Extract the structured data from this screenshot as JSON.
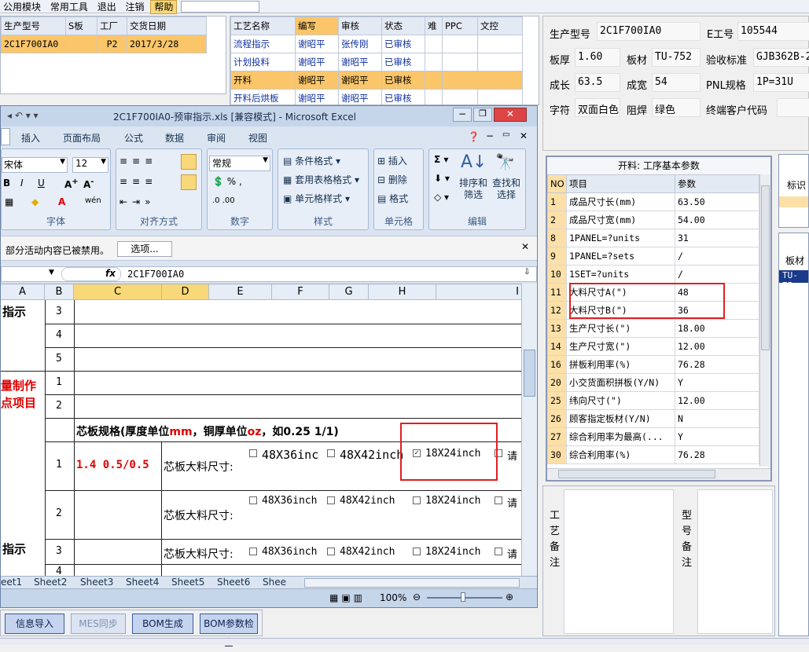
{
  "menubar": {
    "items": [
      "公用模块",
      "常用工具",
      "退出",
      "注销",
      "帮助"
    ],
    "help_arrow": "▾"
  },
  "order_grid": {
    "headers": [
      "生产型号",
      "S板",
      "工厂",
      "交货日期"
    ],
    "rows": [
      [
        "2C1F700IA0",
        "",
        "P2",
        "2017/3/28"
      ]
    ]
  },
  "process_grid": {
    "headers": [
      "工艺名称",
      "编写",
      "审核",
      "状态",
      "难",
      "PPC",
      "文控"
    ],
    "rows": [
      [
        "流程指示",
        "谢昭平",
        "张传刚",
        "已审核",
        "",
        "",
        ""
      ],
      [
        "计划投料",
        "谢昭平",
        "谢昭平",
        "已审核",
        "",
        "",
        ""
      ],
      [
        "开料",
        "谢昭平",
        "谢昭平",
        "已审核",
        "",
        "",
        ""
      ],
      [
        "开料后烘板",
        "谢昭平",
        "谢昭平",
        "已审核",
        "",
        "",
        ""
      ]
    ],
    "selected_row": 2
  },
  "info": {
    "model_label": "生产型号",
    "model_value": "2C1F700IA0",
    "e_label": "E工号",
    "e_value": "105544",
    "thick_label": "板厚",
    "thick_value": "1.60",
    "mat_label": "板材",
    "mat_value": "TU-752",
    "std_label": "验收标准",
    "std_value": "GJB362B-2",
    "len_label": "成长",
    "len_value": "63.5",
    "wid_label": "成宽",
    "wid_value": "54",
    "pnl_label": "PNL规格",
    "pnl_value": "1P=31U",
    "char_label": "字符",
    "char_value": "双面白色",
    "mask_label": "阻焊",
    "mask_value": "绿色",
    "cust_label": "终端客户代码",
    "cust_value": ""
  },
  "params": {
    "title": "开料: 工序基本参数",
    "headers": [
      "NO",
      "项目",
      "参数"
    ],
    "rows": [
      [
        "1",
        "成品尺寸长(mm)",
        "63.50"
      ],
      [
        "2",
        "成品尺寸宽(mm)",
        "54.00"
      ],
      [
        "8",
        "1PANEL=?units",
        "31"
      ],
      [
        "9",
        "1PANEL=?sets",
        "/"
      ],
      [
        "10",
        "1SET=?units",
        "/"
      ],
      [
        "11",
        "大料尺寸A(\")",
        "48"
      ],
      [
        "12",
        "大料尺寸B(\")",
        "36"
      ],
      [
        "13",
        "生产尺寸长(\")",
        "18.00"
      ],
      [
        "14",
        "生产尺寸宽(\")",
        "12.00"
      ],
      [
        "16",
        "拼板利用率(%)",
        "76.28"
      ],
      [
        "20",
        "小交货面积拼板(Y/N)",
        "Y"
      ],
      [
        "25",
        "纬向尺寸(\")",
        "12.00"
      ],
      [
        "26",
        "顾客指定板材(Y/N)",
        "N"
      ],
      [
        "27",
        "综合利用率为最高(...",
        "Y"
      ],
      [
        "30",
        "综合利用率(%)",
        "76.28"
      ]
    ]
  },
  "remarks": {
    "process_label": "工艺备注",
    "model_label": "型号备注"
  },
  "right_strip": {
    "label1": "标识",
    "label2": "板材",
    "value2": "TU-75"
  },
  "excel": {
    "title": "2C1F700IA0-预审指示.xls [兼容模式] - Microsoft Excel",
    "tabs": [
      "插入",
      "页面布局",
      "公式",
      "数据",
      "审阅",
      "视图"
    ],
    "font_name": "宋体",
    "font_size": "12",
    "number_format": "常规",
    "groups": {
      "font": "字体",
      "align": "对齐方式",
      "number": "数字",
      "style": "样式",
      "cells": "单元格",
      "edit": "编辑"
    },
    "style_btns": [
      "条件格式",
      "套用表格格式",
      "单元格样式"
    ],
    "cell_btns": [
      "插入",
      "删除",
      "格式"
    ],
    "edit_btns": [
      "排序和筛选",
      "查找和选择"
    ],
    "security_msg": "部分活动内容已被禁用。",
    "security_btn": "选项...",
    "formula_fx": "fx",
    "formula_value": "2C1F700IA0",
    "col_headers": [
      "A",
      "B",
      "C",
      "D",
      "E",
      "F",
      "G",
      "H",
      "I"
    ],
    "a_texts": {
      "t1": "指示",
      "t2": "量制作",
      "t3": "点项目",
      "t4": "指示"
    },
    "b_values": [
      "3",
      "4",
      "5",
      "1",
      "2",
      "",
      "1",
      "2",
      "3",
      "4"
    ],
    "spec_title_a": "芯板规格(厚度单位",
    "spec_mm": "mm",
    "spec_title_b": "，铜厚单位",
    "spec_oz": "oz",
    "spec_title_c": "，如0.25 1/1)",
    "spec_value": "1.4 0.5/0.5",
    "core_label": "芯板大料尺寸:",
    "opt_48x36": "48X36inch",
    "opt_48x36_short": "48X36inc",
    "opt_48x42": "48X42inch",
    "opt_18x24": "18X24inch",
    "opt_req": "请",
    "sheets": [
      "eet1",
      "Sheet2",
      "Sheet3",
      "Sheet4",
      "Sheet5",
      "Sheet6",
      "Shee"
    ],
    "zoom": "100%"
  },
  "bottom": {
    "btn1": "信息导入",
    "btn2": "MES同步",
    "btn3": "BOM生成",
    "btn4": "BOM参数检查"
  }
}
